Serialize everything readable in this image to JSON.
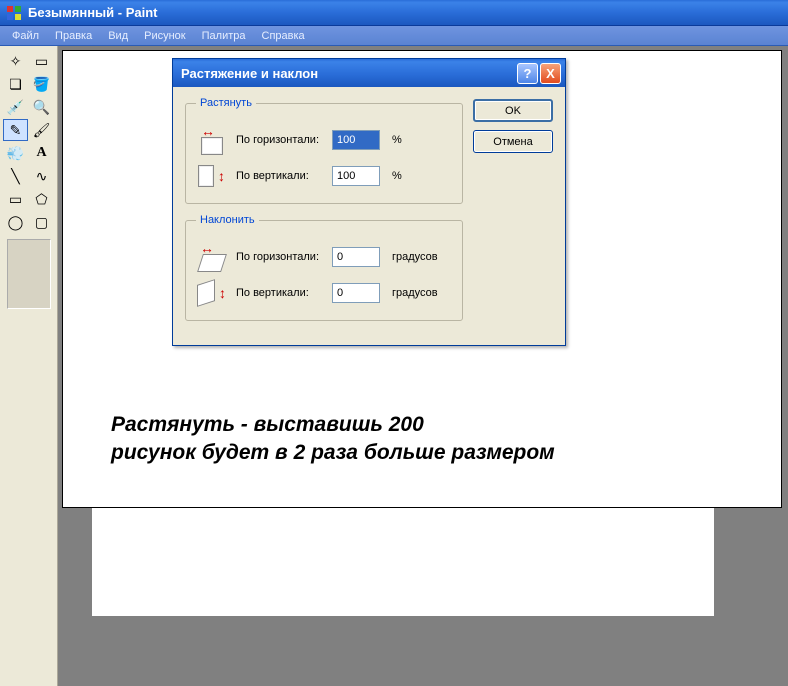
{
  "window": {
    "title": "Безымянный - Paint"
  },
  "menu": {
    "file": "Файл",
    "edit": "Правка",
    "view": "Вид",
    "image": "Рисунок",
    "colors": "Палитра",
    "help": "Справка"
  },
  "dialog": {
    "title": "Растяжение и наклон",
    "ok": "OK",
    "cancel": "Отмена",
    "help": "?",
    "close": "X",
    "stretch": {
      "legend": "Растянуть",
      "h_label": "По горизонтали:",
      "h_value": "100",
      "h_unit": "%",
      "v_label": "По вертикали:",
      "v_value": "100",
      "v_unit": "%"
    },
    "skew": {
      "legend": "Наклонить",
      "h_label": "По горизонтали:",
      "h_value": "0",
      "h_unit": "градусов",
      "v_label": "По вертикали:",
      "v_value": "0",
      "v_unit": "градусов"
    }
  },
  "canvas": {
    "text_line1": "Растянуть - выставишь 200",
    "text_line2": "рисунок будет в 2 раза больше размером"
  },
  "tools": {
    "freeform_select": "✧",
    "rect_select": "▭",
    "eraser": "❏",
    "fill": "🪣",
    "eyedropper": "💉",
    "magnifier": "🔍",
    "pencil": "✎",
    "brush": "🖌",
    "airbrush": "💨",
    "text": "A",
    "line": "╲",
    "curve": "∿",
    "rectangle": "▭",
    "polygon": "⬠",
    "ellipse": "◯",
    "rounded_rect": "▢"
  }
}
